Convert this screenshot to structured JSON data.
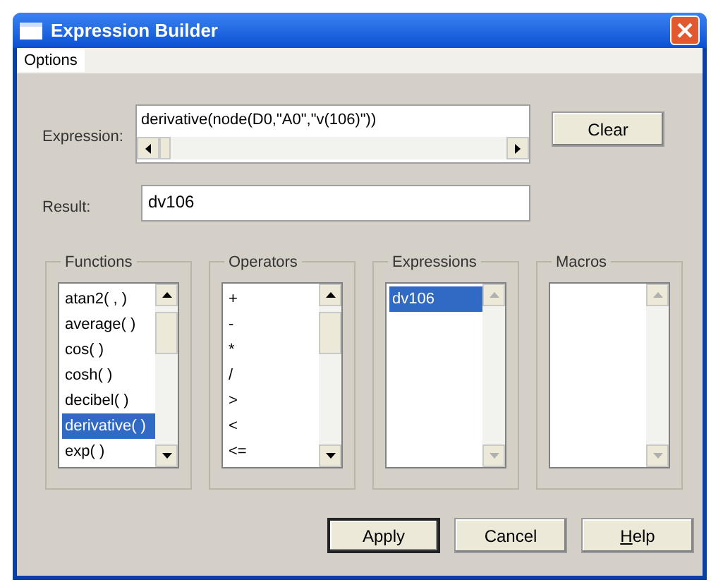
{
  "window": {
    "title": "Expression Builder"
  },
  "menu": [
    {
      "label": "Options"
    }
  ],
  "expression": {
    "label": "Expression:",
    "value": "derivative(node(D0,\"A0\",\"v(106)\"))"
  },
  "result": {
    "label": "Result:",
    "value": "dv106"
  },
  "clear_button": {
    "label": "Clear",
    "default": false
  },
  "groups": [
    {
      "title": "Functions",
      "scroll_enabled": true,
      "items": [
        {
          "label": "atan2( , )",
          "selected": false
        },
        {
          "label": "average( )",
          "selected": false
        },
        {
          "label": "cos( )",
          "selected": false
        },
        {
          "label": "cosh( )",
          "selected": false
        },
        {
          "label": "decibel( )",
          "selected": false
        },
        {
          "label": "derivative( )",
          "selected": true
        },
        {
          "label": "exp( )",
          "selected": false
        }
      ]
    },
    {
      "title": "Operators",
      "scroll_enabled": true,
      "items": [
        {
          "label": "+",
          "selected": false
        },
        {
          "label": "-",
          "selected": false
        },
        {
          "label": "*",
          "selected": false
        },
        {
          "label": "/",
          "selected": false
        },
        {
          "label": ">",
          "selected": false
        },
        {
          "label": "<",
          "selected": false
        },
        {
          "label": "<=",
          "selected": false
        }
      ]
    },
    {
      "title": "Expressions",
      "scroll_enabled": false,
      "items": [
        {
          "label": "dv106",
          "selected": true
        }
      ]
    },
    {
      "title": "Macros",
      "scroll_enabled": false
    }
  ],
  "buttons": [
    {
      "label": "Apply",
      "default": true,
      "underline_first": false
    },
    {
      "label": "Cancel",
      "default": false,
      "underline_first": false
    },
    {
      "label": "Help",
      "default": false,
      "underline_first": true
    }
  ]
}
